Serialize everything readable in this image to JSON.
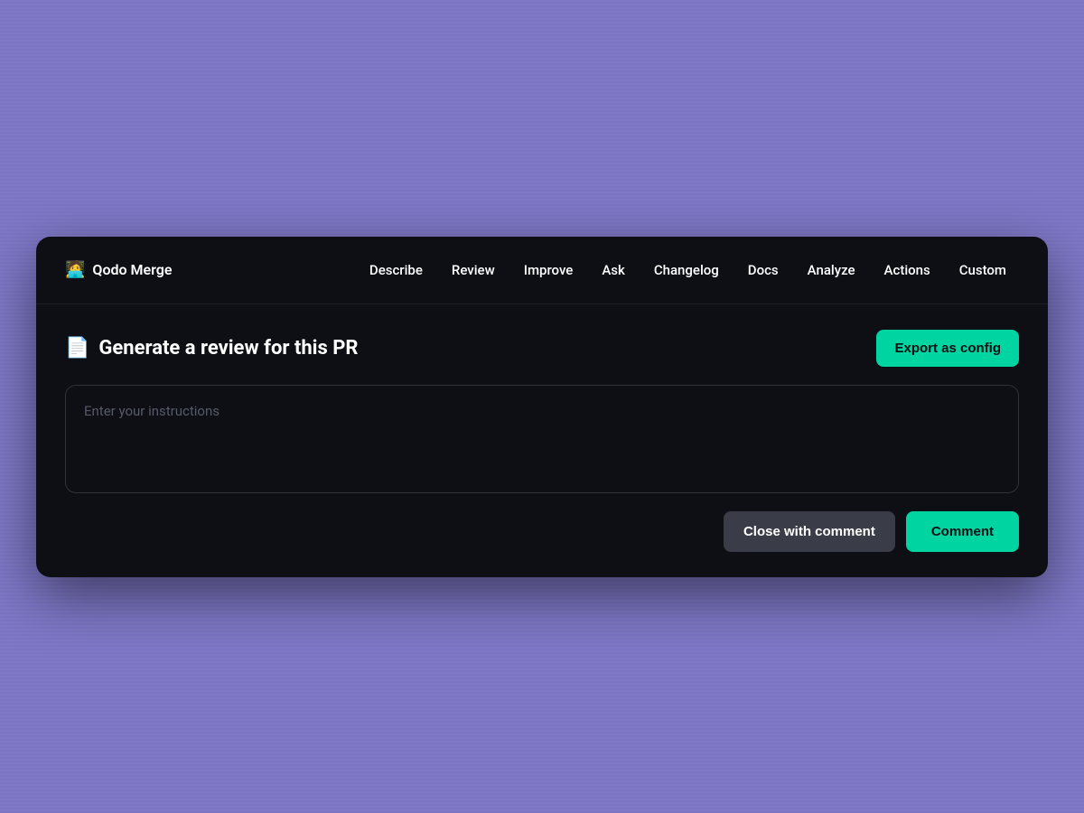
{
  "brand": {
    "emoji": "🧑‍💻",
    "name": "Qodo Merge"
  },
  "navbar": {
    "items": [
      {
        "id": "describe",
        "label": "Describe"
      },
      {
        "id": "review",
        "label": "Review"
      },
      {
        "id": "improve",
        "label": "Improve"
      },
      {
        "id": "ask",
        "label": "Ask"
      },
      {
        "id": "changelog",
        "label": "Changelog"
      },
      {
        "id": "docs",
        "label": "Docs"
      },
      {
        "id": "analyze",
        "label": "Analyze"
      },
      {
        "id": "actions",
        "label": "Actions"
      },
      {
        "id": "custom",
        "label": "Custom"
      }
    ]
  },
  "section": {
    "icon": "📄",
    "title": "Generate a review for this PR",
    "export_button": "Export as config",
    "instructions_placeholder": "Enter your instructions"
  },
  "footer": {
    "close_button": "Close with comment",
    "comment_button": "Comment"
  }
}
